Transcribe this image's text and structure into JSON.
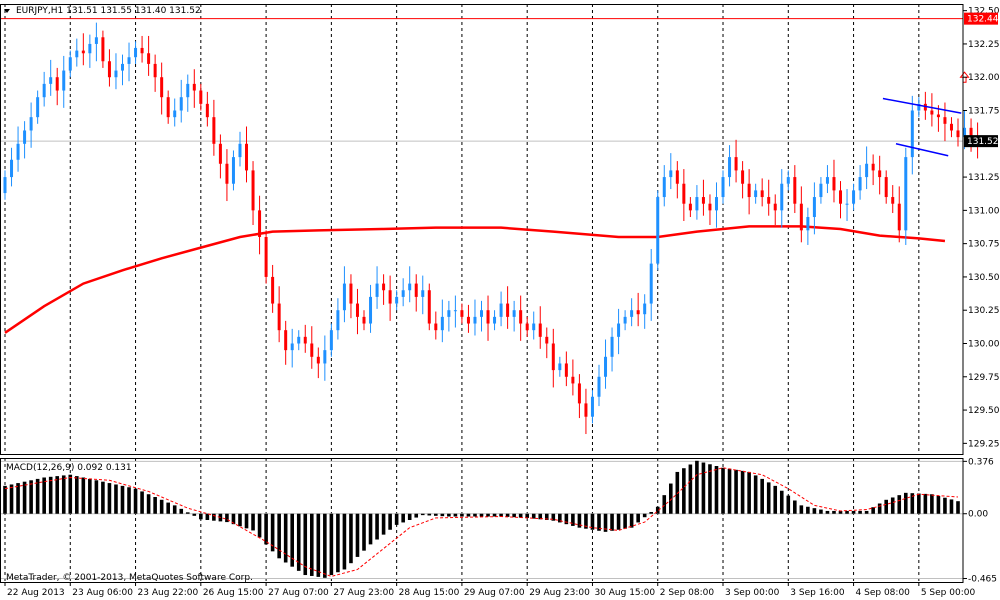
{
  "window": {
    "symbol_line": "EURJPY,H1  131.51 131.55 131.40 131.52",
    "copyright": "MetaTrader, © 2001-2013, MetaQuotes Software Corp."
  },
  "chart_data": [
    {
      "type": "candlestick",
      "title": "EURJPY,H1",
      "quote": {
        "open": 131.51,
        "high": 131.55,
        "low": 131.4,
        "close": 131.52
      },
      "ylim": [
        129.17,
        132.55
      ],
      "y_ticks": [
        {
          "v": 132.5,
          "label": "132.50"
        },
        {
          "v": 132.25,
          "label": "132.25"
        },
        {
          "v": 132.0,
          "label": "132.00"
        },
        {
          "v": 131.75,
          "label": "131.75"
        },
        {
          "v": 131.25,
          "label": "131.25"
        },
        {
          "v": 131.0,
          "label": "131.00"
        },
        {
          "v": 130.75,
          "label": "130.75"
        },
        {
          "v": 130.5,
          "label": "130.50"
        },
        {
          "v": 130.25,
          "label": "130.25"
        },
        {
          "v": 130.0,
          "label": "130.00"
        },
        {
          "v": 129.75,
          "label": "129.75"
        },
        {
          "v": 129.5,
          "label": "129.50"
        },
        {
          "v": 129.25,
          "label": "129.25"
        }
      ],
      "x_range": [
        0,
        146
      ],
      "x_ticks": [
        {
          "x": 0,
          "label": "22 Aug 2013"
        },
        {
          "x": 10,
          "label": "23 Aug 06:00"
        },
        {
          "x": 20,
          "label": "23 Aug 22:00"
        },
        {
          "x": 30,
          "label": "26 Aug 15:00"
        },
        {
          "x": 40,
          "label": "27 Aug 07:00"
        },
        {
          "x": 50,
          "label": "27 Aug 23:00"
        },
        {
          "x": 60,
          "label": "28 Aug 15:00"
        },
        {
          "x": 70,
          "label": "29 Aug 07:00"
        },
        {
          "x": 80,
          "label": "29 Aug 23:00"
        },
        {
          "x": 90,
          "label": "30 Aug 15:00"
        },
        {
          "x": 100,
          "label": "2 Sep 08:00"
        },
        {
          "x": 110,
          "label": "3 Sep 00:00"
        },
        {
          "x": 120,
          "label": "3 Sep 16:00"
        },
        {
          "x": 130,
          "label": "4 Sep 08:00"
        },
        {
          "x": 140,
          "label": "5 Sep 00:00"
        }
      ],
      "horizontal_lines": [
        {
          "v": 132.44,
          "label": "132.44",
          "color": "#ff0000"
        },
        {
          "v": 131.52,
          "label": "131.52",
          "color": "#c0c0c0"
        }
      ],
      "moving_average": {
        "color": "#ff0000",
        "points": [
          [
            0,
            130.08
          ],
          [
            6,
            130.28
          ],
          [
            12,
            130.45
          ],
          [
            18,
            130.55
          ],
          [
            24,
            130.64
          ],
          [
            30,
            130.72
          ],
          [
            36,
            130.8
          ],
          [
            41,
            130.84
          ],
          [
            48,
            130.85
          ],
          [
            58,
            130.86
          ],
          [
            66,
            130.87
          ],
          [
            76,
            130.87
          ],
          [
            84,
            130.84
          ],
          [
            94,
            130.8
          ],
          [
            100,
            130.8
          ],
          [
            106,
            130.84
          ],
          [
            114,
            130.88
          ],
          [
            122,
            130.88
          ],
          [
            128,
            130.86
          ],
          [
            134,
            130.81
          ],
          [
            140,
            130.79
          ],
          [
            144,
            130.77
          ]
        ]
      },
      "channel": {
        "color": "#0000ff",
        "upper": [
          [
            134.5,
            131.84
          ],
          [
            146.5,
            131.73
          ]
        ],
        "lower": [
          [
            136.5,
            131.5
          ],
          [
            144.5,
            131.41
          ]
        ]
      },
      "arrow": {
        "x": 147,
        "v": 132.0,
        "color": "#ff0000"
      },
      "up_color": "#1e90ff",
      "down_color": "#ff0000",
      "closes": [
        131.25,
        131.38,
        131.5,
        131.6,
        131.7,
        131.85,
        131.95,
        132.0,
        131.9,
        132.05,
        132.15,
        132.2,
        132.18,
        132.25,
        132.3,
        132.12,
        132.0,
        132.05,
        132.1,
        132.15,
        132.22,
        132.18,
        132.1,
        132.0,
        131.85,
        131.7,
        131.75,
        131.85,
        131.95,
        131.9,
        131.8,
        131.7,
        131.5,
        131.35,
        131.2,
        131.4,
        131.5,
        131.3,
        131.0,
        130.8,
        130.5,
        130.3,
        130.1,
        129.95,
        130.0,
        130.05,
        130.0,
        129.9,
        129.85,
        129.95,
        130.1,
        130.25,
        130.45,
        130.3,
        130.2,
        130.15,
        130.35,
        130.45,
        130.4,
        130.3,
        130.35,
        130.4,
        130.45,
        130.35,
        130.4,
        130.15,
        130.1,
        130.2,
        130.25,
        130.25,
        130.2,
        130.15,
        130.2,
        130.25,
        130.15,
        130.2,
        130.3,
        130.2,
        130.25,
        130.15,
        130.1,
        130.15,
        130.05,
        130.0,
        129.8,
        129.85,
        129.75,
        129.7,
        129.55,
        129.45,
        129.6,
        129.75,
        129.9,
        130.05,
        130.15,
        130.2,
        130.25,
        130.22,
        130.3,
        130.6,
        131.1,
        131.25,
        131.3,
        131.2,
        131.05,
        131.0,
        131.1,
        131.05,
        131.0,
        131.1,
        131.25,
        131.4,
        131.3,
        131.2,
        131.1,
        131.15,
        131.1,
        131.05,
        131.0,
        131.2,
        131.25,
        131.05,
        130.85,
        130.95,
        131.1,
        131.2,
        131.25,
        131.15,
        131.05,
        131.05,
        131.15,
        131.25,
        131.35,
        131.3,
        131.25,
        131.1,
        131.05,
        130.85,
        131.4,
        131.75,
        131.8,
        131.75,
        131.72,
        131.7,
        131.65,
        131.6,
        131.55,
        131.62,
        131.55,
        131.52
      ]
    },
    {
      "type": "bar",
      "title": "MACD(12,26,9) 0.092 0.131",
      "ylim": [
        -0.49,
        0.4
      ],
      "y_ticks": [
        {
          "v": 0.376,
          "label": "0.376"
        },
        {
          "v": 0.0,
          "label": "0.00"
        },
        {
          "v": -0.465,
          "label": "-0.465"
        }
      ],
      "bar_color": "#000000",
      "signal_color": "#ff0000",
      "anchors": [
        [
          0,
          0.2
        ],
        [
          6,
          0.26
        ],
        [
          10,
          0.28
        ],
        [
          14,
          0.24
        ],
        [
          20,
          0.18
        ],
        [
          26,
          0.06
        ],
        [
          30,
          -0.04
        ],
        [
          34,
          -0.06
        ],
        [
          38,
          -0.12
        ],
        [
          42,
          -0.32
        ],
        [
          46,
          -0.44
        ],
        [
          49,
          -0.46
        ],
        [
          52,
          -0.4
        ],
        [
          56,
          -0.22
        ],
        [
          60,
          -0.08
        ],
        [
          64,
          -0.01
        ],
        [
          68,
          -0.02
        ],
        [
          72,
          -0.02
        ],
        [
          76,
          -0.02
        ],
        [
          80,
          -0.03
        ],
        [
          84,
          -0.05
        ],
        [
          88,
          -0.1
        ],
        [
          92,
          -0.13
        ],
        [
          96,
          -0.1
        ],
        [
          100,
          0.05
        ],
        [
          103,
          0.3
        ],
        [
          106,
          0.38
        ],
        [
          110,
          0.33
        ],
        [
          114,
          0.3
        ],
        [
          118,
          0.2
        ],
        [
          122,
          0.06
        ],
        [
          126,
          0.02
        ],
        [
          132,
          0.02
        ],
        [
          135,
          0.1
        ],
        [
          138,
          0.15
        ],
        [
          142,
          0.14
        ],
        [
          146,
          0.09
        ]
      ],
      "signal_anchors": [
        [
          0,
          0.18
        ],
        [
          6,
          0.23
        ],
        [
          10,
          0.26
        ],
        [
          16,
          0.24
        ],
        [
          22,
          0.16
        ],
        [
          28,
          0.04
        ],
        [
          34,
          -0.04
        ],
        [
          40,
          -0.2
        ],
        [
          46,
          -0.38
        ],
        [
          50,
          -0.45
        ],
        [
          54,
          -0.4
        ],
        [
          58,
          -0.25
        ],
        [
          62,
          -0.1
        ],
        [
          66,
          -0.03
        ],
        [
          76,
          -0.02
        ],
        [
          84,
          -0.04
        ],
        [
          90,
          -0.1
        ],
        [
          94,
          -0.12
        ],
        [
          98,
          -0.06
        ],
        [
          102,
          0.1
        ],
        [
          106,
          0.28
        ],
        [
          110,
          0.33
        ],
        [
          116,
          0.28
        ],
        [
          120,
          0.18
        ],
        [
          124,
          0.06
        ],
        [
          128,
          0.02
        ],
        [
          132,
          0.03
        ],
        [
          136,
          0.08
        ],
        [
          140,
          0.14
        ],
        [
          146,
          0.12
        ]
      ]
    }
  ]
}
